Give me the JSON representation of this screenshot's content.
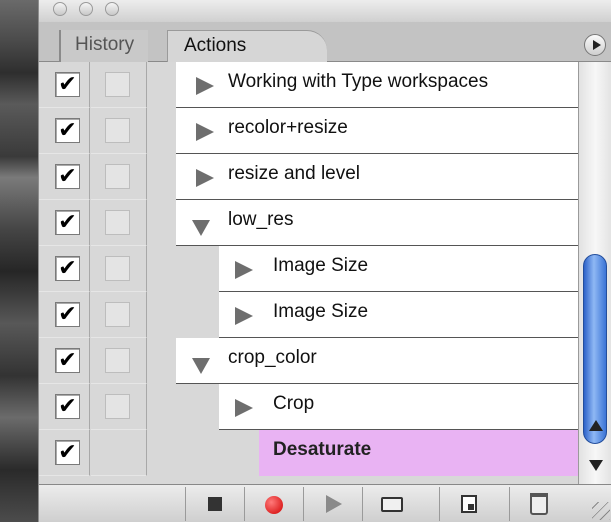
{
  "tabs": {
    "history": "History",
    "actions": "Actions"
  },
  "actions": [
    {
      "label": "Working with Type workspaces",
      "checked": "✔",
      "level": 0,
      "expanded": false,
      "selected": false
    },
    {
      "label": "recolor+resize",
      "checked": "✔",
      "level": 0,
      "expanded": false,
      "selected": false
    },
    {
      "label": "resize and level",
      "checked": "✔",
      "level": 0,
      "expanded": false,
      "selected": false
    },
    {
      "label": "low_res",
      "checked": "✔",
      "level": 0,
      "expanded": true,
      "selected": false
    },
    {
      "label": "Image Size",
      "checked": "✔",
      "level": 1,
      "expanded": false,
      "selected": false
    },
    {
      "label": "Image Size",
      "checked": "✔",
      "level": 1,
      "expanded": false,
      "selected": false
    },
    {
      "label": "crop_color",
      "checked": "✔",
      "level": 0,
      "expanded": true,
      "selected": false
    },
    {
      "label": "Crop",
      "checked": "✔",
      "level": 1,
      "expanded": false,
      "selected": false
    },
    {
      "label": "Desaturate",
      "checked": "✔",
      "level": 2,
      "expanded": false,
      "selected": true
    }
  ],
  "toolbar_icons": [
    "stop-icon",
    "record-icon",
    "play-icon",
    "folder-icon",
    "new-action-icon",
    "trash-icon"
  ],
  "colors": {
    "selected_row": "#e9b3f3",
    "scroll_thumb": "#3b74d6",
    "record": "#d00000"
  }
}
